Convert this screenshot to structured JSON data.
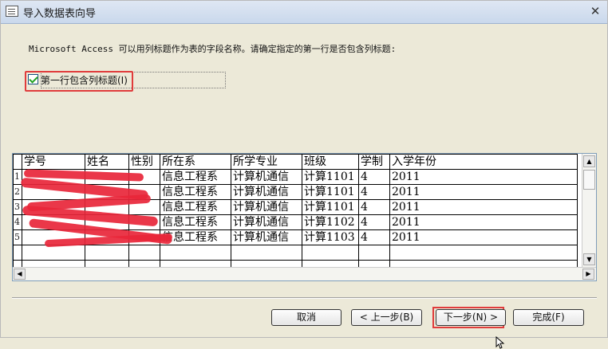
{
  "window": {
    "title": "导入数据表向导"
  },
  "description": "Microsoft Access 可以用列标题作为表的字段名称。请确定指定的第一行是否包含列标题:",
  "checkbox": {
    "label": "第一行包含列标题(I)",
    "checked": true
  },
  "table": {
    "headers": [
      "学号",
      "姓名",
      "性别",
      "所在系",
      "所学专业",
      "班级",
      "学制",
      "入学年份"
    ],
    "row_numbers": [
      "1",
      "2",
      "3",
      "4",
      "5",
      "",
      ""
    ],
    "rows": [
      [
        "",
        "",
        "",
        "信息工程系",
        "计算机通信",
        "计算1101",
        "4",
        "2011"
      ],
      [
        "",
        "",
        "",
        "信息工程系",
        "计算机通信",
        "计算1101",
        "4",
        "2011"
      ],
      [
        "",
        "",
        "",
        "信息工程系",
        "计算机通信",
        "计算1101",
        "4",
        "2011"
      ],
      [
        "",
        "",
        "",
        "信息工程系",
        "计算机通信",
        "计算1102",
        "4",
        "2011"
      ],
      [
        "",
        "",
        "",
        "信息工程系",
        "计算机通信",
        "计算1103",
        "4",
        "2011"
      ],
      [
        "",
        "",
        "",
        "",
        "",
        "",
        "",
        ""
      ],
      [
        "",
        "",
        "",
        "",
        "",
        "",
        "",
        ""
      ]
    ]
  },
  "buttons": {
    "cancel": "取消",
    "back": "< 上一步(B)",
    "next": "下一步(N) >",
    "finish": "完成(F)"
  },
  "colors": {
    "highlight": "#e03c3c",
    "redaction": "#e8263a"
  }
}
